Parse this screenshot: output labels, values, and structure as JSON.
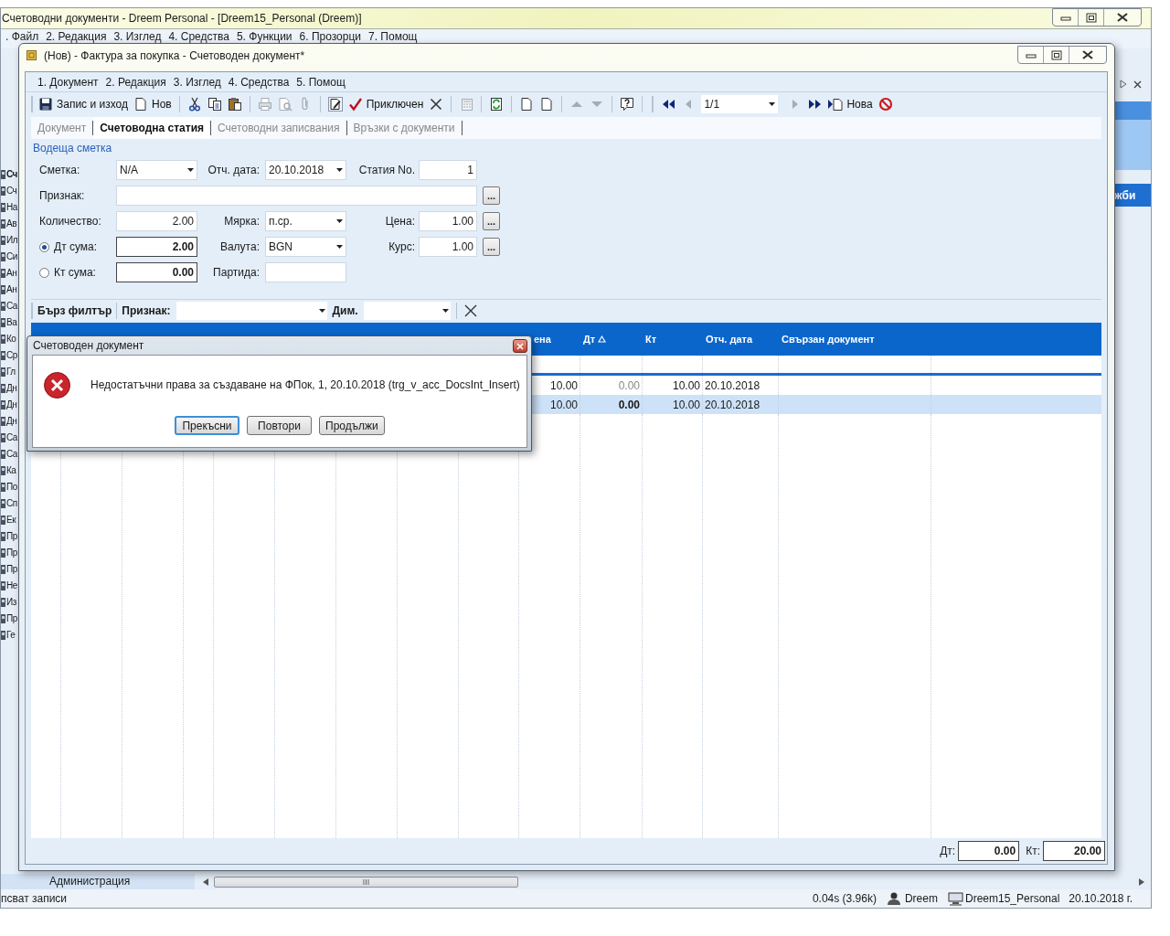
{
  "app_window": {
    "title": "Счетоводни документи - Dreem Personal - [Dreem15_Personal (Dreem)]",
    "menu": [
      ". Файл",
      "2. Редакция",
      "3. Изглед",
      "4. Средства",
      "5. Функции",
      "6. Прозорци",
      "7. Помощ"
    ]
  },
  "navigation_list": [
    {
      "label": "Сч",
      "selected": true
    },
    {
      "label": "Сч",
      "selected": false
    },
    {
      "label": "На",
      "selected": false
    },
    {
      "label": "Ав",
      "selected": false
    },
    {
      "label": "Ил",
      "selected": false
    },
    {
      "label": "Си",
      "selected": false
    },
    {
      "label": "Ан",
      "selected": false
    },
    {
      "label": "Ан",
      "selected": false
    },
    {
      "label": "Са",
      "selected": false
    },
    {
      "label": "Ва",
      "selected": false
    },
    {
      "label": "Ко",
      "selected": false
    },
    {
      "label": "Ср",
      "selected": false
    },
    {
      "label": "Гл",
      "selected": false
    },
    {
      "label": "Дн",
      "selected": false
    },
    {
      "label": "Дн",
      "selected": false
    },
    {
      "label": "Дн",
      "selected": false
    },
    {
      "label": "Са",
      "selected": false
    },
    {
      "label": "Са",
      "selected": false
    },
    {
      "label": "Ка",
      "selected": false
    },
    {
      "label": "По",
      "selected": false
    },
    {
      "label": "Сп",
      "selected": false
    },
    {
      "label": "Ек",
      "selected": false
    },
    {
      "label": "Пр",
      "selected": false
    },
    {
      "label": "Пр",
      "selected": false
    },
    {
      "label": "Пр",
      "selected": false
    },
    {
      "label": "Не",
      "selected": false
    },
    {
      "label": "Из",
      "selected": false
    },
    {
      "label": "Пр",
      "selected": false
    },
    {
      "label": "Ге",
      "selected": false
    }
  ],
  "right_panel": {
    "label": "жби"
  },
  "document_window": {
    "title": "(Нов) - Фактура за покупка - Счетоводен документ*",
    "menu": [
      "1. Документ",
      "2. Редакция",
      "3. Изглед",
      "4. Средства",
      "5. Помощ"
    ],
    "toolbar": {
      "position": "1/1",
      "buttons": [
        {
          "label": "Запис и изход",
          "disabled": false
        },
        {
          "label": "Нов",
          "disabled": false
        },
        {
          "disabled": false
        },
        {
          "disabled": false
        },
        {
          "disabled": false
        },
        {
          "disabled": true
        },
        {
          "disabled": true
        },
        {
          "disabled": true
        },
        {
          "disabled": false
        },
        {
          "label": "Приключен",
          "disabled": false
        },
        {
          "disabled": false
        },
        {
          "disabled": true
        },
        {
          "disabled": false
        },
        {
          "disabled": false
        },
        {
          "disabled": false
        },
        {
          "disabled": true
        },
        {
          "disabled": true
        },
        {
          "disabled": false
        },
        {
          "disabled": false
        },
        {
          "disabled": true
        },
        {
          "disabled": true
        },
        {
          "disabled": false
        },
        {
          "label": "Нова",
          "disabled": false
        },
        {
          "disabled": false
        }
      ]
    },
    "tabs": [
      {
        "label": "Документ",
        "selected": false
      },
      {
        "label": "Счетоводна статия",
        "selected": true
      },
      {
        "label": "Счетоводни записвания",
        "selected": false
      },
      {
        "label": "Връзки с документи",
        "selected": false
      }
    ],
    "section_title": "Водеща сметка",
    "form": {
      "rows": [
        [
          {
            "label": "Сметка:",
            "kind": "combo",
            "value": "N/A"
          },
          {
            "label": "Отч. дата:",
            "kind": "combo",
            "value": "20.10.2018"
          },
          {
            "label": "Статия No.",
            "kind": "number",
            "value": "1"
          }
        ],
        [
          {
            "label": "Признак:",
            "kind": "wide_lookup",
            "button": "..."
          }
        ],
        [
          {
            "label": "Количество:",
            "kind": "number",
            "value": "2.00"
          },
          {
            "label": "Мярка:",
            "kind": "combo",
            "value": "п.ср."
          },
          {
            "label": "Цена:",
            "kind": "number_lookup",
            "value": "1.00",
            "button": "..."
          }
        ],
        [
          {
            "label": "Дт сума:",
            "kind": "amount",
            "selected": true,
            "value": "2.00"
          },
          {
            "label": "Валута:",
            "kind": "combo",
            "value": "BGN"
          },
          {
            "label": "Курс:",
            "kind": "number_lookup",
            "value": "1.00",
            "button": "..."
          }
        ],
        [
          {
            "label": "Кт сума:",
            "kind": "amount",
            "selected": false,
            "value": "0.00"
          },
          {
            "label": "Партида:",
            "kind": "text"
          }
        ]
      ]
    },
    "quick_filter": {
      "title": "Бърз филтър",
      "fields": [
        {
          "label": "Признак:"
        },
        {
          "label": "Дим."
        }
      ]
    },
    "table": {
      "columns": [
        {
          "label": "ена",
          "sorted": false
        },
        {
          "label": "Дт",
          "sorted": true
        },
        {
          "label": "Кт",
          "sorted": false
        },
        {
          "label": "Отч. дата",
          "sorted": false
        },
        {
          "label": "Свързан документ",
          "sorted": false
        }
      ],
      "rows": [
        {
          "selected": false,
          "cells": [
            "10.00",
            "0.00",
            "10.00",
            "20.10.2018"
          ]
        },
        {
          "selected": true,
          "cells": [
            "10.00",
            "0.00",
            "10.00",
            "20.10.2018"
          ]
        }
      ]
    },
    "totals": [
      {
        "label": "Дт:",
        "value": "0.00"
      },
      {
        "label": "Кт:",
        "value": "20.00"
      }
    ]
  },
  "dialog": {
    "title": "Счетоводен документ",
    "message": "Недостатъчни права за създаване на ФПок, 1, 20.10.2018 (trg_v_acc_DocsInt_Insert)",
    "buttons": [
      {
        "label": "Прекъсни",
        "selected": true
      },
      {
        "label": "Повтори",
        "selected": false
      },
      {
        "label": "Продължи",
        "selected": false
      }
    ]
  },
  "bottom_panel": {
    "label": "Администрация"
  },
  "status_bar": {
    "message": "псват записи",
    "timing": "0.04s (3.96k)",
    "user": "Dreem",
    "database": "Dreem15_Personal",
    "date": "20.10.2018 г."
  }
}
